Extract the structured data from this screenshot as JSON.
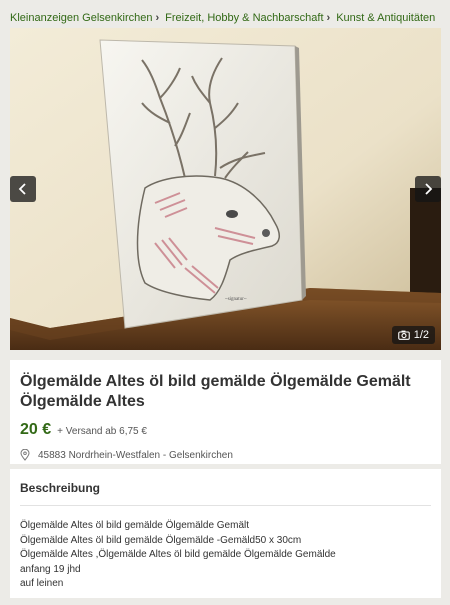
{
  "breadcrumb": [
    {
      "label": "Kleinanzeigen Gelsenkirchen"
    },
    {
      "label": "Freizeit, Hobby & Nachbarschaft"
    },
    {
      "label": "Kunst & Antiquitäten"
    }
  ],
  "gallery": {
    "counter": "1/2",
    "prev_icon": "chevron-left-icon",
    "next_icon": "chevron-right-icon",
    "camera_icon": "camera-icon"
  },
  "listing": {
    "title": "Ölgemälde Altes öl bild gemälde Ölgemälde Gemält Ölgemälde Altes",
    "price": "20 €",
    "shipping": "+ Versand ab 6,75 €",
    "location": "45883 Nordrhein-Westfalen - Gelsenkirchen",
    "location_icon": "location-pin-icon"
  },
  "description": {
    "heading": "Beschreibung",
    "lines": [
      "Ölgemälde Altes öl bild gemälde Ölgemälde Gemält",
      "Ölgemälde Altes öl bild gemälde Ölgemälde -Gemäld50 x 30cm",
      "Ölgemälde Altes ,Ölgemälde Altes öl bild gemälde Ölgemälde Gemälde",
      "anfang 19 jhd",
      "auf leinen"
    ]
  },
  "colors": {
    "brand_green": "#326916",
    "page_bg": "#ecebe7"
  }
}
